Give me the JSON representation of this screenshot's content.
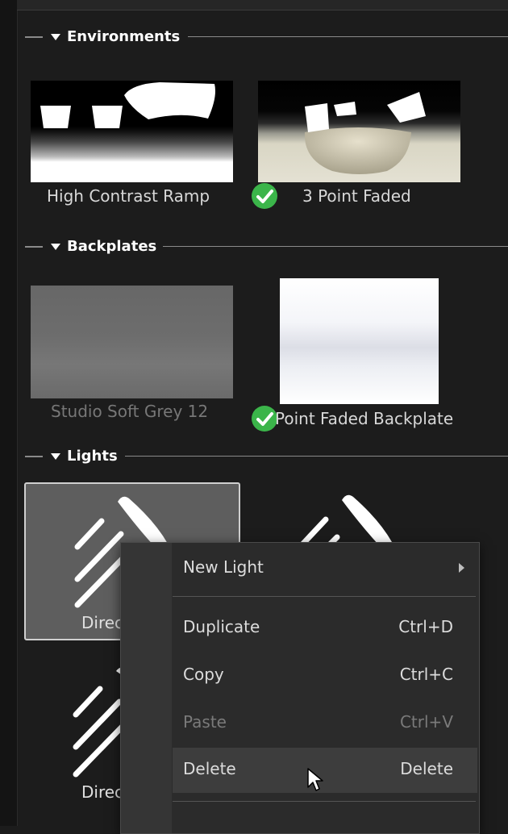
{
  "sections": {
    "environments": {
      "title": "Environments"
    },
    "backplates": {
      "title": "Backplates"
    },
    "lights": {
      "title": "Lights"
    }
  },
  "environments": [
    {
      "label": "High Contrast Ramp",
      "active": false
    },
    {
      "label": "3 Point Faded",
      "active": true
    }
  ],
  "backplates": [
    {
      "label": "Studio Soft Grey 12",
      "active": false
    },
    {
      "label": "Point Faded Backplate",
      "active": true
    }
  ],
  "lights": [
    {
      "label": "Direc",
      "selected": true
    },
    {
      "label": "Direc",
      "selected": false
    }
  ],
  "context_menu": {
    "new_light": {
      "label": "New Light"
    },
    "duplicate": {
      "label": "Duplicate",
      "shortcut": "Ctrl+D"
    },
    "copy": {
      "label": "Copy",
      "shortcut": "Ctrl+C"
    },
    "paste": {
      "label": "Paste",
      "shortcut": "Ctrl+V"
    },
    "delete": {
      "label": "Delete",
      "shortcut": "Delete"
    }
  },
  "colors": {
    "check": "#3bb54a",
    "selected_tile": "#5e5e5e"
  },
  "icons": [
    "triangle-down-icon",
    "check-icon",
    "directional-light-icon",
    "submenu-arrow-icon",
    "mouse-cursor-icon"
  ]
}
